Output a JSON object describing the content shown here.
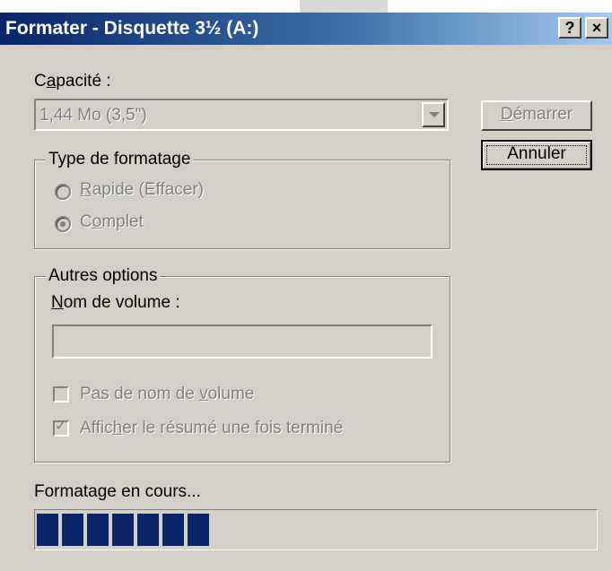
{
  "window": {
    "title": "Formater - Disquette 3½ (A:)",
    "help_button": "?",
    "close_button": "×"
  },
  "capacity": {
    "label_prefix": "C",
    "label_underlined": "a",
    "label_suffix": "pacité :",
    "value": "1,44 Mo (3,5\")"
  },
  "buttons": {
    "start_prefix": "",
    "start_underlined": "D",
    "start_suffix": "émarrer",
    "cancel": "Annuler"
  },
  "format_type": {
    "legend": "Type de formatage",
    "options": [
      {
        "prefix": "",
        "underlined": "R",
        "suffix": "apide (Effacer)",
        "selected": false
      },
      {
        "prefix": "C",
        "underlined": "o",
        "suffix": "mplet",
        "selected": true
      }
    ]
  },
  "other_options": {
    "legend": "Autres options",
    "volume_label_underlined": "N",
    "volume_label_suffix": "om de volume :",
    "volume_value": "",
    "checkbox1": {
      "prefix": "Pas de nom de ",
      "underlined": "v",
      "suffix": "olume",
      "checked": false
    },
    "checkbox2": {
      "prefix": "Affic",
      "underlined": "h",
      "suffix": "er le résumé une fois terminé",
      "checked": true
    }
  },
  "status": {
    "text": "Formatage en cours...",
    "progress_fraction": 0.32
  },
  "colors": {
    "title_gradient_start": "#0a246a",
    "progress_block": "#0a246a",
    "dialog_bg": "#d4d0c8"
  }
}
